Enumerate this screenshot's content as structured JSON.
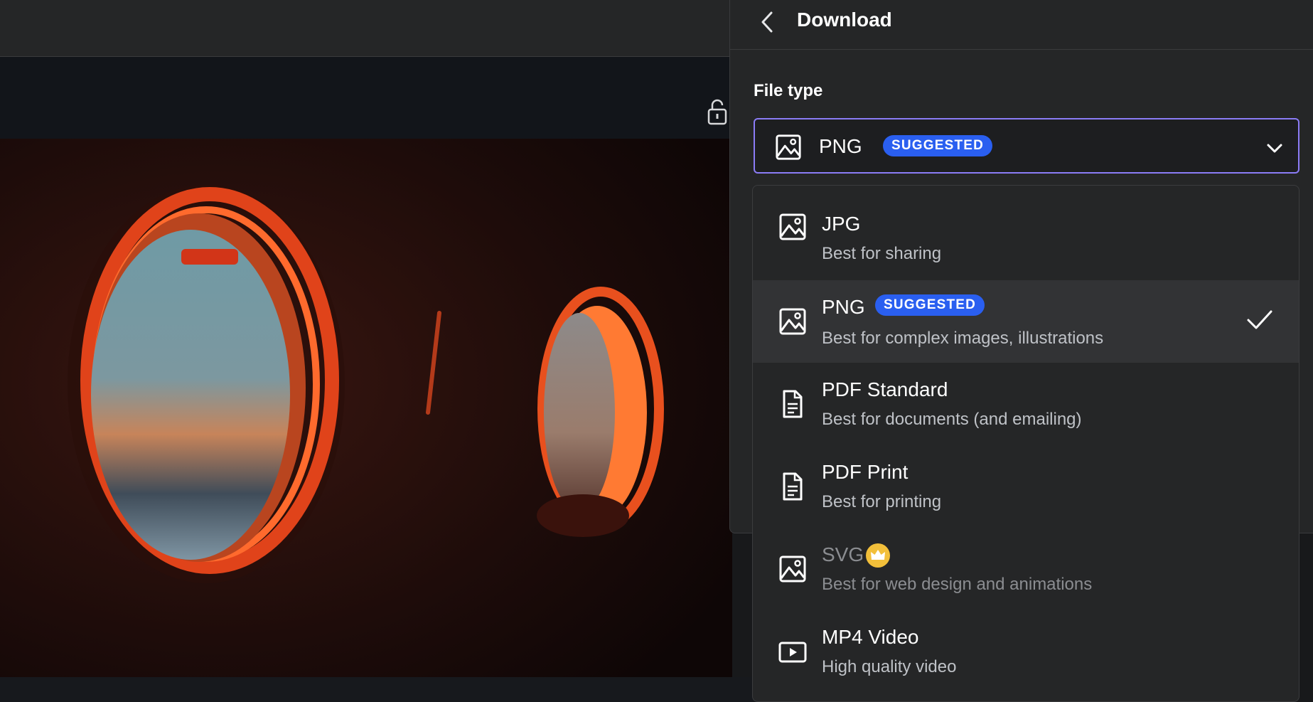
{
  "panel": {
    "title": "Download",
    "file_type_label": "File type",
    "selected_value": "PNG",
    "selected_badge": "SUGGESTED"
  },
  "menu": {
    "items": [
      {
        "name": "JPG",
        "description": "Best for sharing",
        "icon": "image-icon"
      },
      {
        "name": "PNG",
        "description": "Best for complex images, illustrations",
        "badge": "SUGGESTED",
        "icon": "image-icon",
        "selected": true
      },
      {
        "name": "PDF Standard",
        "description": "Best for documents (and emailing)",
        "icon": "document-icon"
      },
      {
        "name": "PDF Print",
        "description": "Best for printing",
        "icon": "document-icon"
      },
      {
        "name": "SVG",
        "description": "Best for web design and animations",
        "icon": "image-icon",
        "premium": true
      },
      {
        "name": "MP4 Video",
        "description": "High quality video",
        "icon": "video-icon"
      }
    ]
  },
  "colors": {
    "accent_border": "#8b7cf6",
    "badge_blue": "#2a5ff0",
    "crown_gold": "#f2bf3a",
    "panel_bg": "#252627"
  }
}
